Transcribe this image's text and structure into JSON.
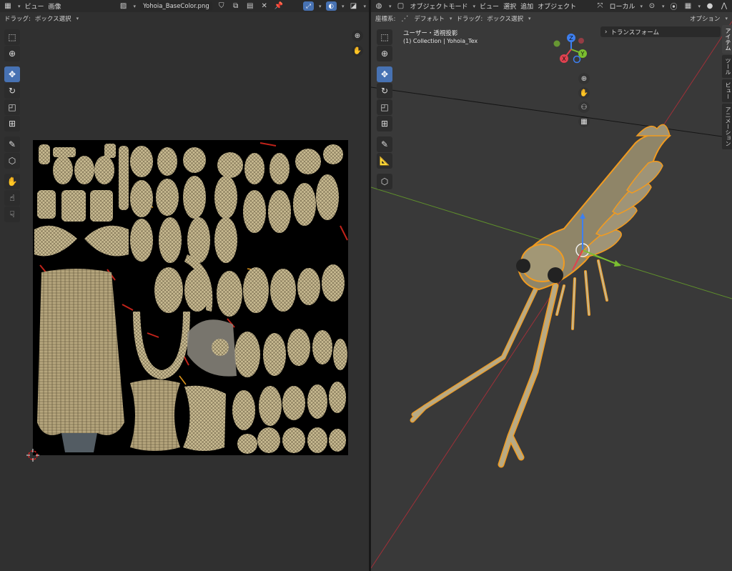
{
  "uv_editor": {
    "header": {
      "editor_icon": "uv-editor-icon",
      "menus": [
        "ビュー",
        "画像"
      ],
      "image_name": "Yohoia_BaseColor.png"
    },
    "subheader": {
      "drag_label": "ドラッグ:",
      "drag_value": "ボックス選択"
    }
  },
  "viewport": {
    "header": {
      "mode": "オブジェクトモード",
      "menus": [
        "ビュー",
        "選択",
        "追加",
        "オブジェクト"
      ],
      "transform_orientation": "ローカル"
    },
    "subheader": {
      "coord_label": "座標系:",
      "coord_value": "デフォルト",
      "drag_label": "ドラッグ:",
      "drag_value": "ボックス選択",
      "options_label": "オプション"
    },
    "overlay": {
      "view_name": "ユーザー・透視投影",
      "collection_info": "(1) Collection | Yohoia_Tex"
    },
    "gizmo": {
      "x": "X",
      "y": "Y",
      "z": "Z"
    },
    "npanel": {
      "transform_label": "トランスフォーム",
      "tabs": [
        "アイテム",
        "ツール",
        "ビュー",
        "アニメーション"
      ]
    }
  },
  "colors": {
    "accent": "#4772b3",
    "axis_x": "#e0414f",
    "axis_y": "#7bbf30",
    "axis_z": "#3d7ff0",
    "selection_outline": "#f29b1f"
  }
}
